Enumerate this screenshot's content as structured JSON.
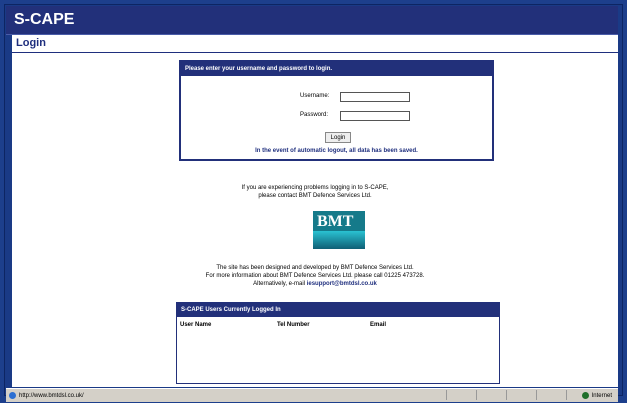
{
  "app": {
    "title": "S-CAPE"
  },
  "page": {
    "title": "Login"
  },
  "login_box": {
    "header": "Please enter your username and password to login.",
    "username_label": "Username:",
    "password_label": "Password:",
    "username_value": "",
    "password_value": "",
    "button_label": "Login",
    "note": "In the event of automatic logout, all data has been saved."
  },
  "help": {
    "line1": "If you are experiencing problems logging in to S-CAPE,",
    "line2": "please contact BMT Defence Services Ltd."
  },
  "logo": {
    "text": "BMT"
  },
  "credits": {
    "line1": "The site has been designed and developed by BMT Defence Services Ltd.",
    "line2": "For more information about BMT Defence Services Ltd. please call 01225 473728.",
    "line3_prefix": "Alternatively, e-mail ",
    "email": "iesupport@bmtdsl.co.uk"
  },
  "users_box": {
    "header": "S-CAPE Users Currently Logged In",
    "columns": [
      "User Name",
      "Tel Number",
      "Email"
    ]
  },
  "statusbar": {
    "url": "http://www.bmtdsl.co.uk/",
    "zone": "Internet"
  }
}
